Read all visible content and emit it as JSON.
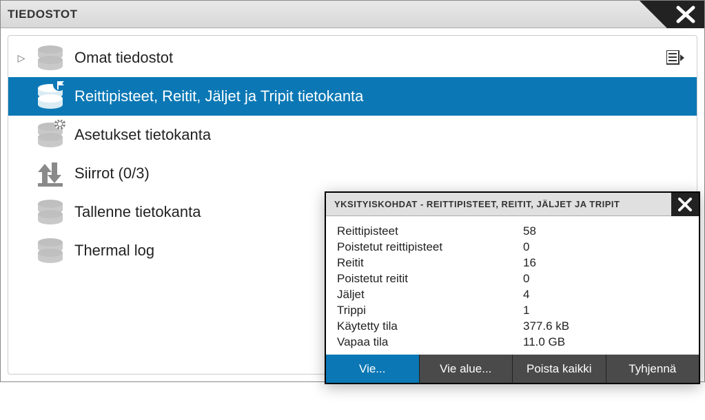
{
  "main": {
    "title": "TIEDOSTOT",
    "items": [
      {
        "label": "Omat tiedostot",
        "icon": "db",
        "selected": false,
        "expandable": true,
        "action": true
      },
      {
        "label": "Reittipisteet, Reitit, Jäljet ja Tripit tietokanta",
        "icon": "db-flag",
        "selected": true,
        "expandable": false,
        "action": false
      },
      {
        "label": "Asetukset tietokanta",
        "icon": "db-gear",
        "selected": false,
        "expandable": false,
        "action": false
      },
      {
        "label": "Siirrot (0/3)",
        "icon": "transfer",
        "selected": false,
        "expandable": false,
        "action": false
      },
      {
        "label": "Tallenne tietokanta",
        "icon": "db",
        "selected": false,
        "expandable": false,
        "action": false
      },
      {
        "label": "Thermal log",
        "icon": "db",
        "selected": false,
        "expandable": false,
        "action": false
      }
    ]
  },
  "details": {
    "title": "YKSITYISKOHDAT - REITTIPISTEET, REITIT, JÄLJET JA TRIPIT",
    "rows": [
      {
        "key": "Reittipisteet",
        "val": "58"
      },
      {
        "key": "Poistetut reittipisteet",
        "val": "0"
      },
      {
        "key": "Reitit",
        "val": "16"
      },
      {
        "key": "Poistetut reitit",
        "val": "0"
      },
      {
        "key": "Jäljet",
        "val": "4"
      },
      {
        "key": "Trippi",
        "val": "1"
      },
      {
        "key": "Käytetty tila",
        "val": "377.6 kB"
      },
      {
        "key": "Vapaa tila",
        "val": "11.0 GB"
      }
    ],
    "buttons": [
      {
        "label": "Vie...",
        "primary": true
      },
      {
        "label": "Vie alue...",
        "primary": false
      },
      {
        "label": "Poista kaikki",
        "primary": false
      },
      {
        "label": "Tyhjennä",
        "primary": false
      }
    ]
  }
}
